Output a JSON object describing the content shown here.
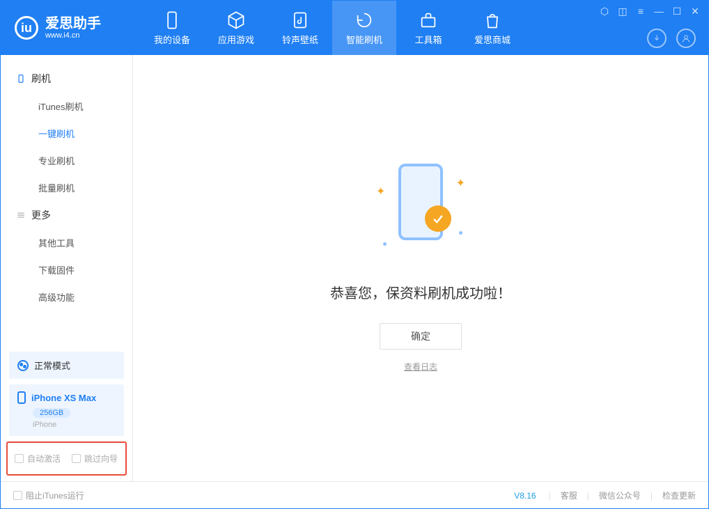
{
  "app": {
    "name": "爱思助手",
    "site": "www.i4.cn"
  },
  "tabs": [
    {
      "label": "我的设备"
    },
    {
      "label": "应用游戏"
    },
    {
      "label": "铃声壁纸"
    },
    {
      "label": "智能刷机"
    },
    {
      "label": "工具箱"
    },
    {
      "label": "爱思商城"
    }
  ],
  "sidebar": {
    "group_flash": "刷机",
    "items_flash": [
      {
        "label": "iTunes刷机"
      },
      {
        "label": "一键刷机"
      },
      {
        "label": "专业刷机"
      },
      {
        "label": "批量刷机"
      }
    ],
    "group_more": "更多",
    "items_more": [
      {
        "label": "其他工具"
      },
      {
        "label": "下载固件"
      },
      {
        "label": "高级功能"
      }
    ]
  },
  "mode": {
    "label": "正常模式"
  },
  "device": {
    "name": "iPhone XS Max",
    "storage": "256GB",
    "type": "iPhone"
  },
  "options": {
    "auto_activate": "自动激活",
    "skip_guide": "跳过向导"
  },
  "main": {
    "message": "恭喜您，保资料刷机成功啦！",
    "confirm": "确定",
    "view_log": "查看日志"
  },
  "footer": {
    "block_itunes": "阻止iTunes运行",
    "version": "V8.16",
    "support": "客服",
    "wechat": "微信公众号",
    "update": "检查更新"
  }
}
